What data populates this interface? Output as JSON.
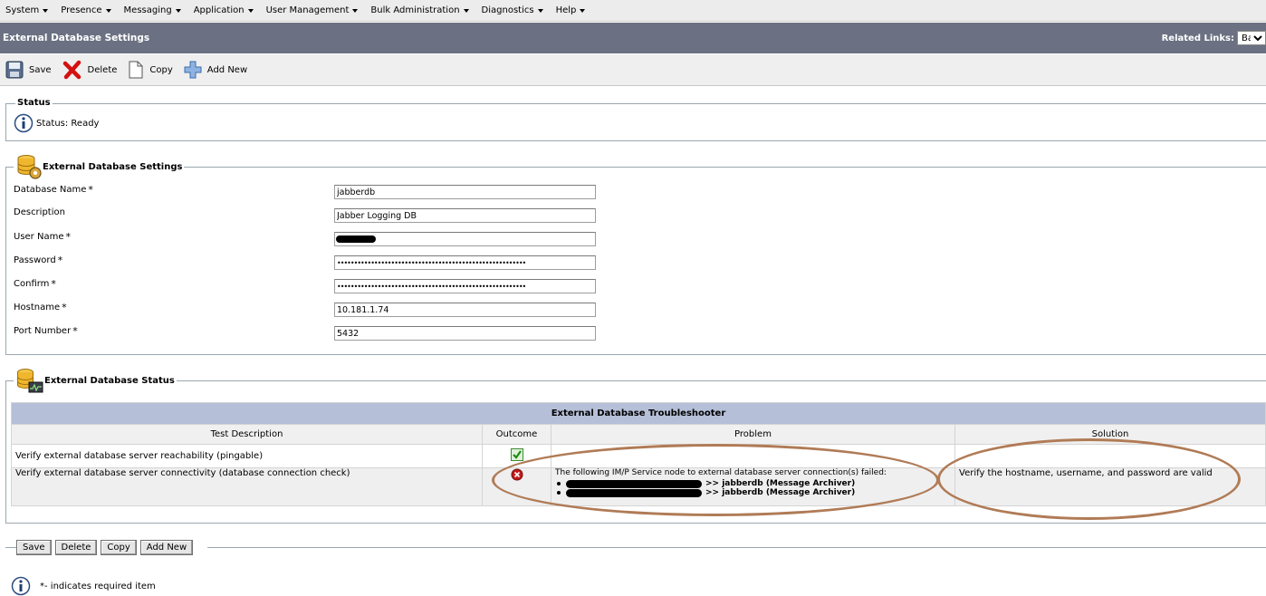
{
  "menu": [
    "System",
    "Presence",
    "Messaging",
    "Application",
    "User Management",
    "Bulk Administration",
    "Diagnostics",
    "Help"
  ],
  "title_bar": {
    "title": "External Database Settings",
    "related_links_label": "Related Links:",
    "related_links_value": "Back"
  },
  "toolbar": {
    "save": "Save",
    "delete": "Delete",
    "copy": "Copy",
    "add_new": "Add New"
  },
  "status": {
    "legend": "Status",
    "text": "Status: Ready"
  },
  "settings": {
    "legend": "External Database Settings",
    "fields": [
      {
        "label": "Database Name",
        "required": "*",
        "value": "jabberdb"
      },
      {
        "label": "Description",
        "required": "",
        "value": "Jabber Logging DB"
      },
      {
        "label": "User Name",
        "required": "*",
        "value": ""
      },
      {
        "label": "Password",
        "required": "*",
        "value": "••••••••••••••••••••••••••••••••••••••••••••••••••••••••"
      },
      {
        "label": "Confirm",
        "required": "*",
        "value": "••••••••••••••••••••••••••••••••••••••••••••••••••••••••"
      },
      {
        "label": "Hostname",
        "required": "*",
        "value": "10.181.1.74"
      },
      {
        "label": "Port Number",
        "required": "*",
        "value": "5432"
      }
    ]
  },
  "db_status": {
    "legend": "External Database Status",
    "troubleshooter": {
      "caption": "External Database Troubleshooter",
      "headers": [
        "Test Description",
        "Outcome",
        "Problem",
        "Solution"
      ],
      "rows": [
        {
          "description": "Verify external database server reachability (pingable)",
          "problem": "",
          "solution": ""
        },
        {
          "description": "Verify external database server connectivity (database connection check)",
          "problem": "The following IM/P Service node to external database server connection(s) failed:",
          "problem_items": [
            ">> jabberdb (Message Archiver)",
            ">> jabberdb (Message Archiver)"
          ],
          "solution": "Verify the hostname, username, and password are valid"
        }
      ]
    }
  },
  "bottom_buttons": [
    "Save",
    "Delete",
    "Copy",
    "Add New"
  ],
  "footnote": "*- indicates required item",
  "colors": {
    "title_bar": "#6b7182",
    "troubleshooter_caption": "#b6bfd8",
    "annotation": "#b07b56"
  }
}
